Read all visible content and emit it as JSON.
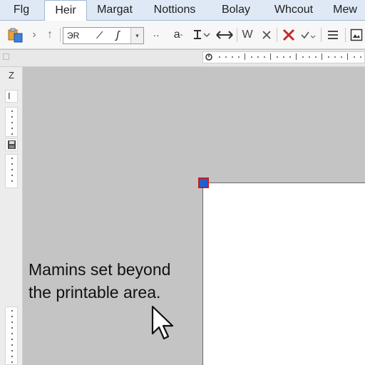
{
  "tabs": [
    {
      "label": "Flg"
    },
    {
      "label": "Heir",
      "active": true
    },
    {
      "label": "Margat"
    },
    {
      "label": "Nottions"
    },
    {
      "label": "Bolay"
    },
    {
      "label": "Whcout"
    },
    {
      "label": "Mew"
    }
  ],
  "toolbar": {
    "font_value": "ЭR",
    "font_style_glyph_1": "⁄",
    "font_style_glyph_2": "ʃ",
    "text_a_label": "a",
    "text_w_label": "W"
  },
  "ruler": {
    "side_tool_1": "Z",
    "side_tool_2": "I"
  },
  "message": {
    "line1": "Mamins set beyond",
    "line2": "the printable area."
  },
  "colors": {
    "accent": "#1f5fd6",
    "handle_border": "#c21c1c",
    "delete_red": "#c62828",
    "workspace": "#c4c4c4"
  },
  "icons": [
    "paste-icon",
    "forward-arrow-icon",
    "up-arrow-icon",
    "more-dots-icon",
    "text-direction-icon",
    "resize-horizontal-icon",
    "close-icon",
    "delete-x-icon",
    "check-dropdown-icon",
    "menu-icon",
    "image-frame-icon",
    "cursor-arrow-icon"
  ]
}
